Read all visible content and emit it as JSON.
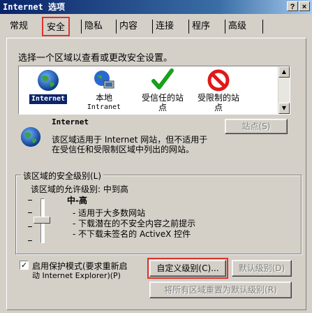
{
  "window": {
    "title": "Internet 选项",
    "help_label": "?",
    "close_label": "×"
  },
  "tabs": [
    {
      "label": "常规"
    },
    {
      "label": "安全"
    },
    {
      "label": "隐私"
    },
    {
      "label": "内容"
    },
    {
      "label": "连接"
    },
    {
      "label": "程序"
    },
    {
      "label": "高级"
    }
  ],
  "security": {
    "instruction": "选择一个区域以查看或更改安全设置。",
    "zones": [
      {
        "line1": "Internet",
        "line2": "",
        "icon": "globe-icon"
      },
      {
        "line1": "本地",
        "line2": "Intranet",
        "icon": "intranet-icon"
      },
      {
        "line1": "受信任的站",
        "line2": "点",
        "icon": "checkmark-icon"
      },
      {
        "line1": "受限制的站",
        "line2": "点",
        "icon": "restricted-icon"
      }
    ],
    "selected_zone": {
      "name": "Internet",
      "description_line1": "该区域适用于 Internet 网站，但不适用于",
      "description_line2": "在受信任和受限制区域中列出的网站。"
    },
    "sites_button": "站点(S)",
    "level_group_label": "该区域的安全级别(L)",
    "allowed_levels": "该区域的允许级别: 中到高",
    "slider": {
      "level_name": "中-高",
      "bullet1": "- 适用于大多数网站",
      "bullet2": "- 下载潜在的不安全内容之前提示",
      "bullet3": "- 不下载未签名的 ActiveX 控件",
      "level_fraction": 0.5
    },
    "protected_mode_line1": "启用保护模式(要求重新启",
    "protected_mode_line2": "动 Internet Explorer)(P)",
    "protected_mode_checked": "✓",
    "custom_level_button": "自定义级别(C)...",
    "default_level_button": "默认级别(D)",
    "reset_all_button": "将所有区域重置为默认级别(R)"
  }
}
